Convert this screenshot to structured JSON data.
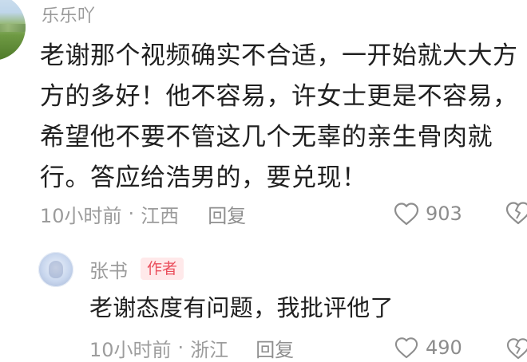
{
  "top_comment": {
    "username": "乐乐吖",
    "content": "老谢那个视频确实不合适，一开始就大大方方的多好！他不容易，许女士更是不容易，希望他不要不管这几个无辜的亲生骨肉就行。答应给浩男的，要兑现！",
    "time": "10小时前",
    "location": "江西",
    "reply_label": "回复",
    "likes": "903"
  },
  "reply_comment": {
    "username": "张书",
    "author_badge": "作者",
    "content": "老谢态度有问题，我批评他了",
    "time": "10小时前",
    "location": "浙江",
    "reply_label": "回复",
    "likes": "490"
  },
  "separator": "·",
  "icons": {
    "like": "heart-outline-icon",
    "dislike": "heart-broken-icon"
  },
  "colors": {
    "author_badge_bg": "#ffe9ea",
    "author_badge_text": "#ea4f5d",
    "meta_text": "#9b9b9b"
  }
}
